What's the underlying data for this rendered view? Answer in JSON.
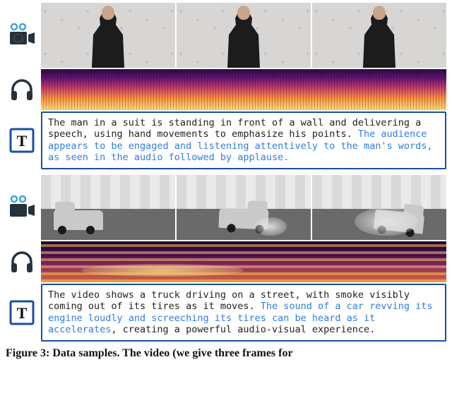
{
  "samples": [
    {
      "caption_visual": "The man in a suit is standing in front of a wall and delivering a speech, using hand movements to emphasize his points. ",
      "caption_audio": "The audience appears to be engaged and listening attentively to the man's words, as seen in the audio followed by applause."
    },
    {
      "caption_visual": "The video shows a truck driving on a street, with smoke visibly coming out of its tires as it moves. ",
      "caption_audio": "The sound of a car revving its engine loudly and screeching its tires can be heard as it accelerates",
      "caption_tail": ", creating a powerful audio-visual experience."
    }
  ],
  "icons": {
    "video": "video-camera-icon",
    "audio": "headphones-icon",
    "text": "text-box-icon"
  },
  "figure_caption": "Figure 3: Data samples. The video (we give three frames for"
}
